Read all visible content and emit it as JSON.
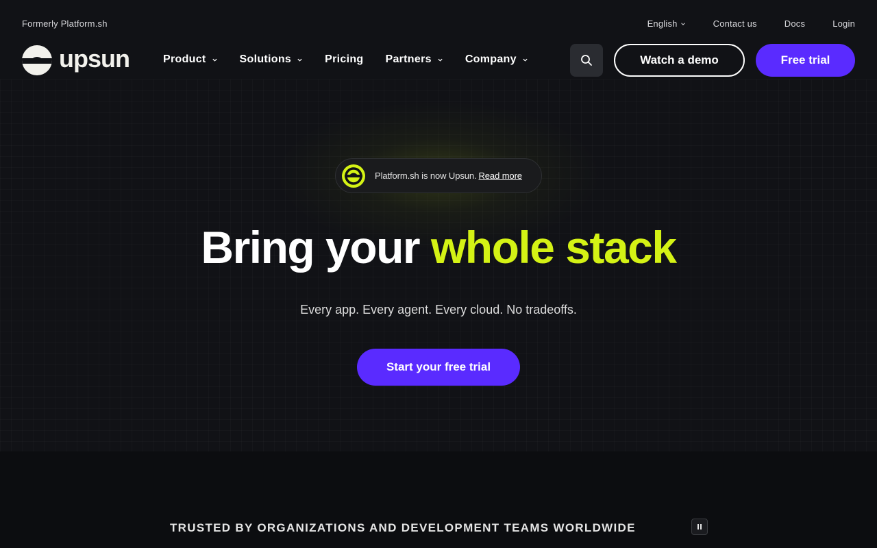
{
  "utility": {
    "formerly": "Formerly Platform.sh",
    "language": "English",
    "contact": "Contact us",
    "docs": "Docs",
    "login": "Login"
  },
  "brand": {
    "name": "upsun",
    "accent_color": "#d4f215",
    "primary_color": "#5a2bff"
  },
  "nav": {
    "items": [
      {
        "label": "Product",
        "has_dropdown": true
      },
      {
        "label": "Solutions",
        "has_dropdown": true
      },
      {
        "label": "Pricing",
        "has_dropdown": false
      },
      {
        "label": "Partners",
        "has_dropdown": true
      },
      {
        "label": "Company",
        "has_dropdown": true
      }
    ],
    "search_icon": "search-icon",
    "demo_label": "Watch a demo",
    "trial_label": "Free trial"
  },
  "hero": {
    "announce_text": "Platform.sh is now Upsun.",
    "announce_link": "Read more",
    "headline_start": "Bring your",
    "headline_accent": "whole stack",
    "subhead": "Every app. Every agent. Every cloud. No tradeoffs.",
    "cta_label": "Start your free trial"
  },
  "trusted": {
    "title": "TRUSTED BY ORGANIZATIONS AND DEVELOPMENT TEAMS WORLDWIDE",
    "pause_icon": "pause-icon"
  }
}
